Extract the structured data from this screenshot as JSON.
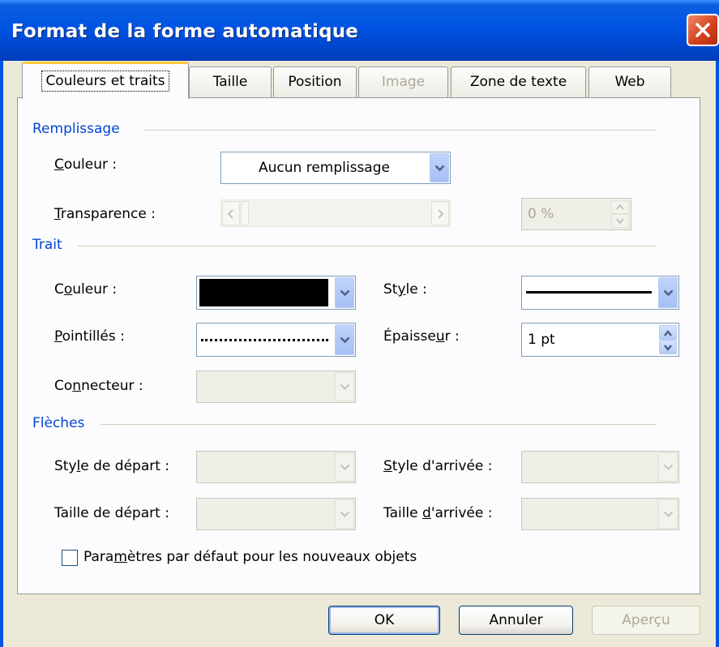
{
  "window": {
    "title": "Format de la forme automatique"
  },
  "tabs": [
    {
      "label": "Couleurs et traits"
    },
    {
      "label": "Taille"
    },
    {
      "label": "Position"
    },
    {
      "label": "Image"
    },
    {
      "label": "Zone de texte"
    },
    {
      "label": "Web"
    }
  ],
  "fill": {
    "section": "Remplissage",
    "color_label": "Couleur :",
    "color_value": "Aucun remplissage",
    "transparency_label": "Transparence :",
    "transparency_value": "0 %"
  },
  "line": {
    "section": "Trait",
    "color_label": "Couleur :",
    "color_value": "#000000",
    "style_label": "Style :",
    "dash_label": "Pointillés :",
    "weight_label": "Épaisseur :",
    "weight_value": "1 pt",
    "connector_label": "Connecteur :"
  },
  "arrows": {
    "section": "Flèches",
    "begin_style_label": "Style de départ :",
    "end_style_label": "Style d'arrivée :",
    "begin_size_label": "Taille de départ :",
    "end_size_label": "Taille d'arrivée :"
  },
  "default_checkbox_label": "Paramètres par défaut pour les nouveaux objets",
  "buttons": {
    "ok": "OK",
    "cancel": "Annuler",
    "preview": "Aperçu"
  },
  "icons": [
    "close-icon",
    "chevron-down-icon",
    "scroll-left-icon",
    "scroll-right-icon",
    "spin-up-icon",
    "spin-down-icon"
  ]
}
